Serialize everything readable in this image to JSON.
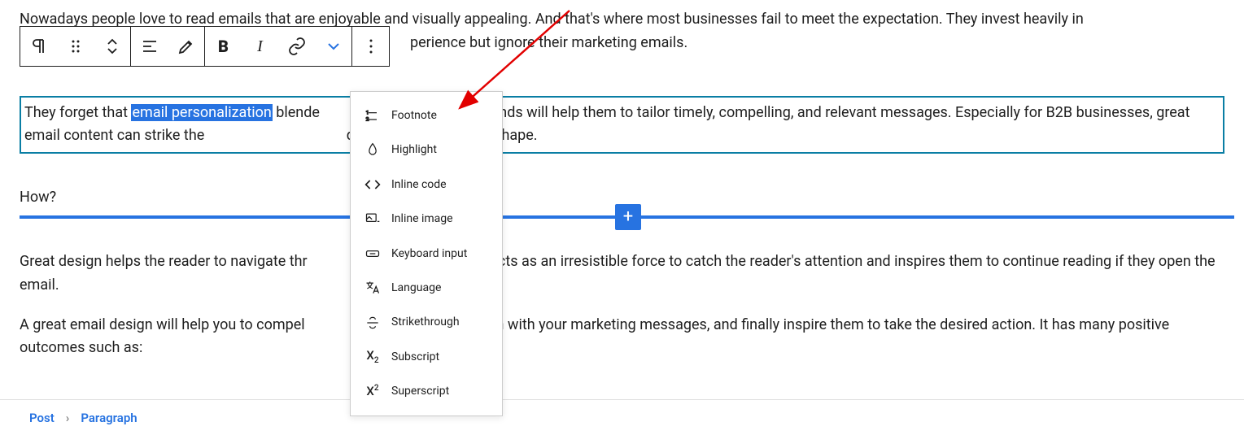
{
  "paragraphs": {
    "p1_part1": "Nowadays people love to read emails that are enjoyable and visually appealing. And that's where most businesses fail to meet the expectation. They invest heavily in",
    "p1_part2": "perience but ignore their marketing emails.",
    "p2_before": "They forget that ",
    "p2_highlight": "email personalization",
    "p2_after": " blende",
    "p2_cont": "gn trends will help them to tailor timely, compelling, and relevant messages. Especially for B2B businesses, great email content can strike the",
    "p2_end": "design makes it hot to shape.",
    "p3": "How?",
    "p4": "Great design helps the reader to navigate thr",
    "p4_cont": "acts as an irresistible force to catch the reader's attention and inspires them to continue reading if they open the email.",
    "p5": "A great email design will help you to compel",
    "p5_cont": "em with your marketing messages, and finally inspire them to take the desired action. It has many positive outcomes such as:"
  },
  "menu": {
    "footnote": "Footnote",
    "highlight": "Highlight",
    "inline_code": "Inline code",
    "inline_image": "Inline image",
    "keyboard_input": "Keyboard input",
    "language": "Language",
    "strikethrough": "Strikethrough",
    "subscript": "Subscript",
    "superscript": "Superscript"
  },
  "breadcrumb": {
    "post": "Post",
    "paragraph": "Paragraph"
  },
  "insertion": {
    "plus": "+"
  }
}
